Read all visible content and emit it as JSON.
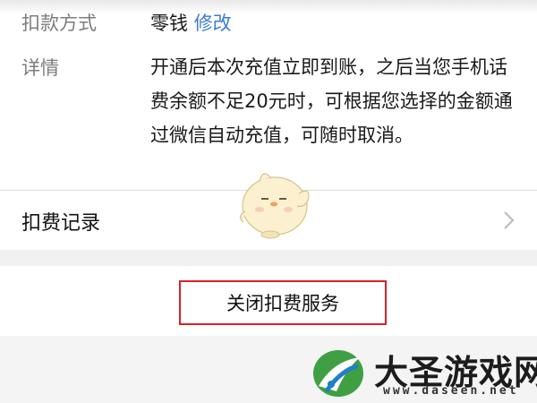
{
  "payment": {
    "method_label": "扣款方式",
    "method_value": "零钱",
    "modify_link": "修改"
  },
  "details": {
    "label": "详情",
    "text": "开通后本次充值立即到账，之后当您手机话费余额不足20元时，可根据您选择的金额通过微信自动充值，可随时取消。"
  },
  "records": {
    "label": "扣费记录"
  },
  "actions": {
    "close_service": "关闭扣费服务"
  },
  "watermark": {
    "title": "大圣游戏网",
    "url": "www.daseen.net"
  },
  "colors": {
    "link": "#3a7bd5",
    "highlight_border": "#d8212b",
    "logo_green": "#3ea043",
    "logo_blue": "#1f7fc4"
  },
  "icons": {
    "chevron": "chevron-right-icon",
    "mascot": "chick-mascot-icon",
    "logo": "site-logo-icon"
  }
}
